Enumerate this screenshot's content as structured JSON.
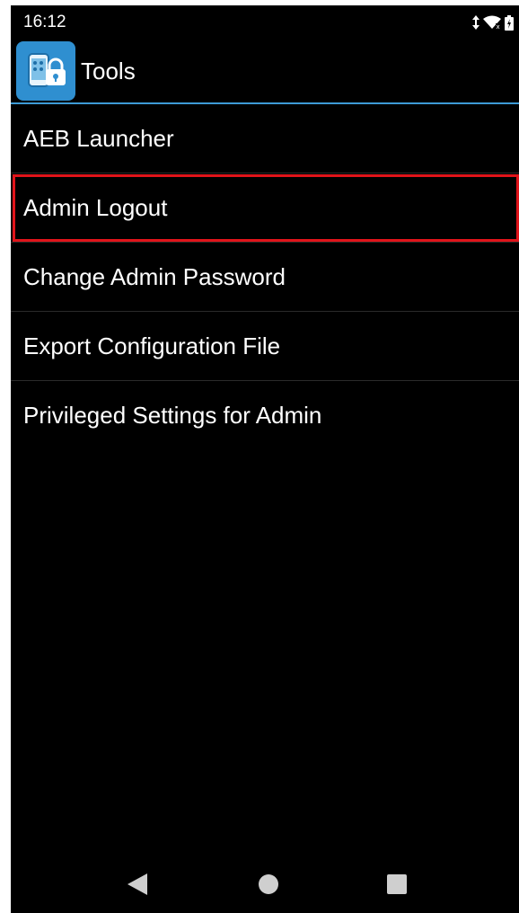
{
  "status_bar": {
    "time": "16:12",
    "icons": [
      "data-arrows-icon",
      "wifi-icon",
      "battery-icon"
    ]
  },
  "app_bar": {
    "icon": "phone-lock-icon",
    "title": "Tools",
    "accent_color": "#3d9bd6"
  },
  "menu": {
    "items": [
      {
        "label": "AEB Launcher"
      },
      {
        "label": "Admin Logout",
        "highlighted": true
      },
      {
        "label": "Change Admin Password"
      },
      {
        "label": "Export Configuration File"
      },
      {
        "label": "Privileged Settings for Admin"
      }
    ],
    "highlight_color": "#e0141a"
  },
  "nav_bar": {
    "buttons": [
      "back-icon",
      "home-icon",
      "recents-icon"
    ]
  }
}
